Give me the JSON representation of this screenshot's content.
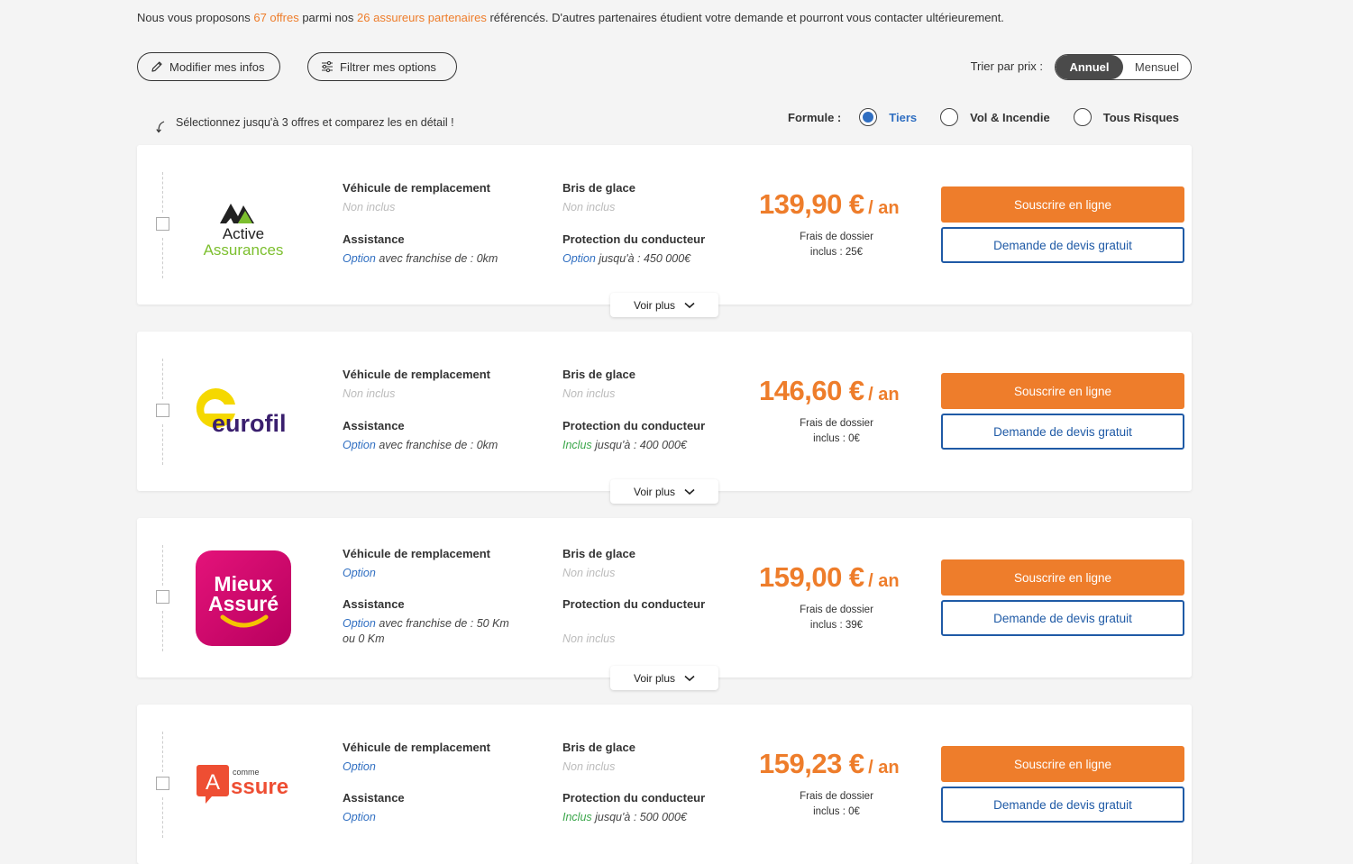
{
  "intro": {
    "p1": "Nous vous proposons ",
    "offers": "67 offres",
    "p2": " parmi nos ",
    "partners": "26 assureurs partenaires",
    "p3": " référencés. D'autres partenaires étudient votre demande et pourront vous contacter ultérieurement."
  },
  "toolbar": {
    "edit_label": "Modifier mes infos",
    "filter_label": "Filtrer mes options",
    "sort_label": "Trier par prix :",
    "sort_annual": "Annuel",
    "sort_monthly": "Mensuel"
  },
  "select_hint": "Sélectionnez jusqu'à 3 offres et comparez les en détail !",
  "formule": {
    "label": "Formule :",
    "options": [
      "Tiers",
      "Vol & Incendie",
      "Tous Risques"
    ],
    "selected": "Tiers"
  },
  "labels": {
    "vehicle": "Véhicule de remplacement",
    "glass": "Bris de glace",
    "assistance": "Assistance",
    "driver": "Protection du conducteur",
    "fees_line1": "Frais de dossier",
    "unit": "/ an",
    "subscribe": "Souscrire en ligne",
    "quote": "Demande de devis gratuit",
    "more": "Voir plus"
  },
  "offers": [
    {
      "logo": "Active Assurances",
      "logo_line1": "Active",
      "logo_line2": "Assurances",
      "vehicle": "Non inclus",
      "glass": "Non inclus",
      "assistance_status": "Option",
      "assistance_rest": " avec franchise de : 0km",
      "driver_status": "Option",
      "driver_rest": " jusqu'à : 450 000€",
      "price": "139,90 €",
      "fees": "inclus : 25€"
    },
    {
      "logo": "eurofil",
      "vehicle": "Non inclus",
      "glass": "Non inclus",
      "assistance_status": "Option",
      "assistance_rest": " avec franchise de : 0km",
      "driver_status": "Inclus",
      "driver_rest": " jusqu'à : 400 000€",
      "price": "146,60 €",
      "fees": "inclus : 0€"
    },
    {
      "logo": "Mieux Assuré",
      "logo_line1": "Mieux",
      "logo_line2": "Assuré",
      "vehicle": "Option",
      "glass": "Non inclus",
      "assistance_status": "Option",
      "assistance_rest": " avec franchise de : 50 Km ou 0 Km",
      "driver_value": "Non inclus",
      "price": "159,00 €",
      "fees": "inclus : 39€"
    },
    {
      "logo": "A comme assure",
      "logo_small": "comme",
      "logo_letter": "A",
      "logo_word": "ssure",
      "vehicle": "Option",
      "glass": "Non inclus",
      "assistance_status": "Option",
      "driver_status": "Inclus",
      "driver_rest": " jusqu'à : 500 000€",
      "price": "159,23 €",
      "fees": "inclus : 0€"
    }
  ],
  "colors": {
    "accent_orange": "#ee7d2b",
    "accent_blue": "#2f6ec1",
    "included_green": "#3aa64a"
  }
}
